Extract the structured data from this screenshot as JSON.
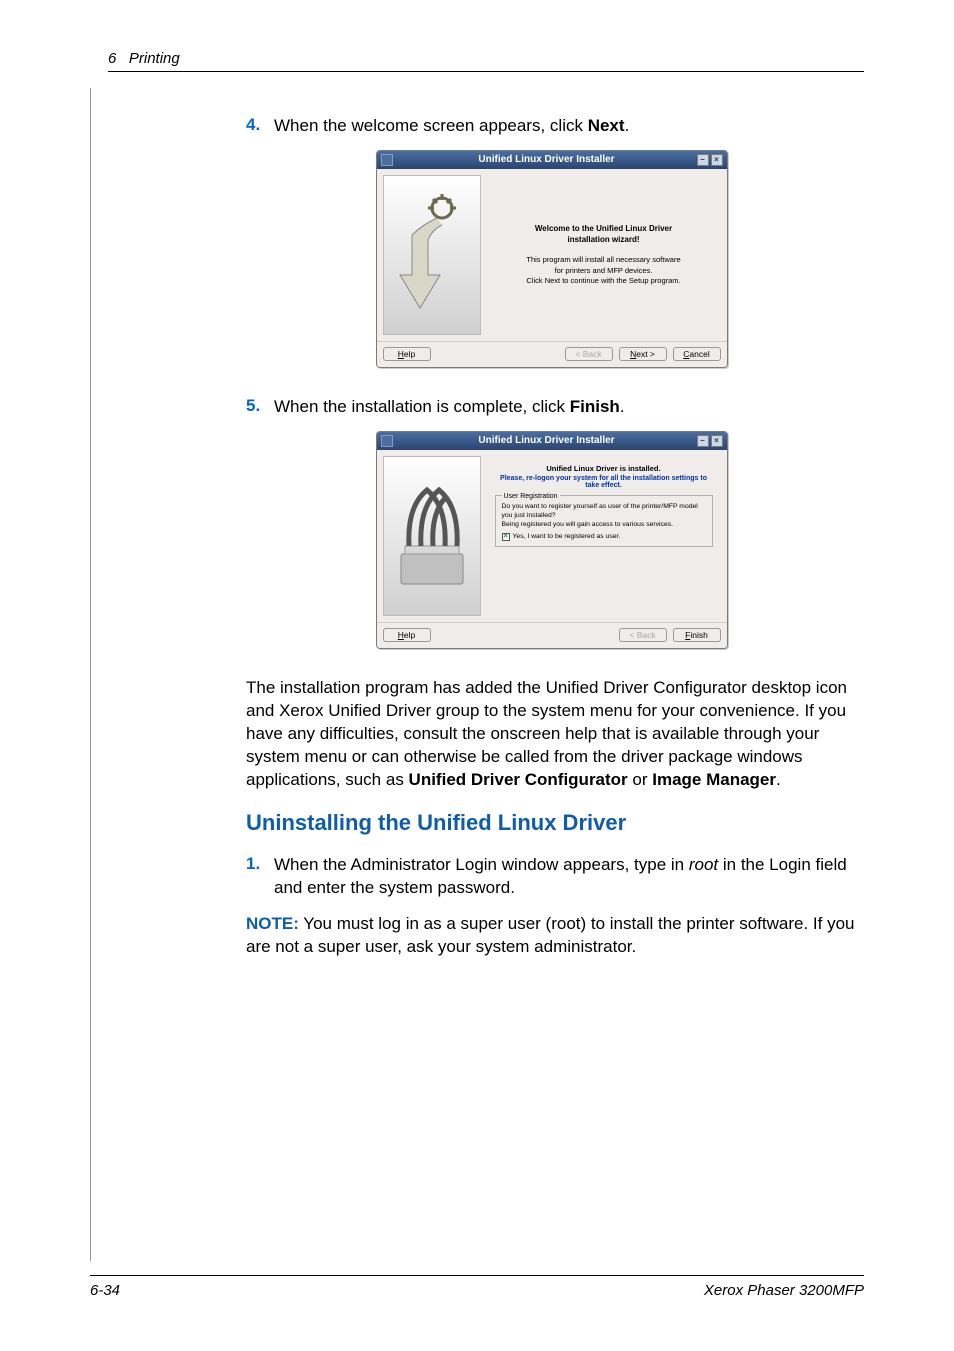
{
  "header": {
    "chapter_num": "6",
    "chapter_title": "Printing"
  },
  "steps": {
    "s4": {
      "num": "4.",
      "text_prefix": "When the welcome screen appears, click ",
      "bold": "Next",
      "suffix": "."
    },
    "s5": {
      "num": "5.",
      "text_prefix": "When the installation is complete, click ",
      "bold": "Finish",
      "suffix": "."
    },
    "s1b": {
      "num": "1.",
      "text_prefix": "When the Administrator Login window appears, type in ",
      "italic": "root",
      "suffix": " in the Login field and enter the system password."
    }
  },
  "dialog1": {
    "title": "Unified Linux Driver Installer",
    "msg_line1": "Welcome to the Unified Linux Driver",
    "msg_line2": "installation wizard!",
    "sub1": "This program will install all necessary software",
    "sub2": "for printers and MFP devices.",
    "sub3": "Click Next to continue with the Setup program.",
    "help": "Help",
    "back": "< Back",
    "next": "Next >",
    "cancel": "Cancel"
  },
  "dialog2": {
    "title": "Unified Linux Driver Installer",
    "installed": "Unified Linux Driver is installed.",
    "relogon": "Please, re-logon your system for all the installation settings to take effect.",
    "fs_legend": "User Registration",
    "fs_body": "Do you want to register yourself as user of the printer/MFP model you just installed?\nBeing registered you will gain access to various services.",
    "chk_label": "Yes, I want to be registered as user.",
    "help": "Help",
    "back": "< Back",
    "finish": "Finish"
  },
  "body_para": "The installation program has added the Unified Driver Configurator desktop icon and Xerox Unified Driver group to the system menu for your convenience. If you have any difficulties, consult the onscreen help that is available through your system menu or can otherwise be called from the driver package windows applications, such as ",
  "body_bold1": "Unified Driver Configurator",
  "body_mid": " or ",
  "body_bold2": "Image Manager",
  "body_end": ".",
  "heading2": "Uninstalling the Unified Linux Driver",
  "note": {
    "label": "NOTE:",
    "text": " You must log in as a super user (root) to install the printer software. If you are not a super user, ask your system administrator."
  },
  "footer": {
    "pagenum": "6-34",
    "product": "Xerox Phaser 3200MFP"
  }
}
